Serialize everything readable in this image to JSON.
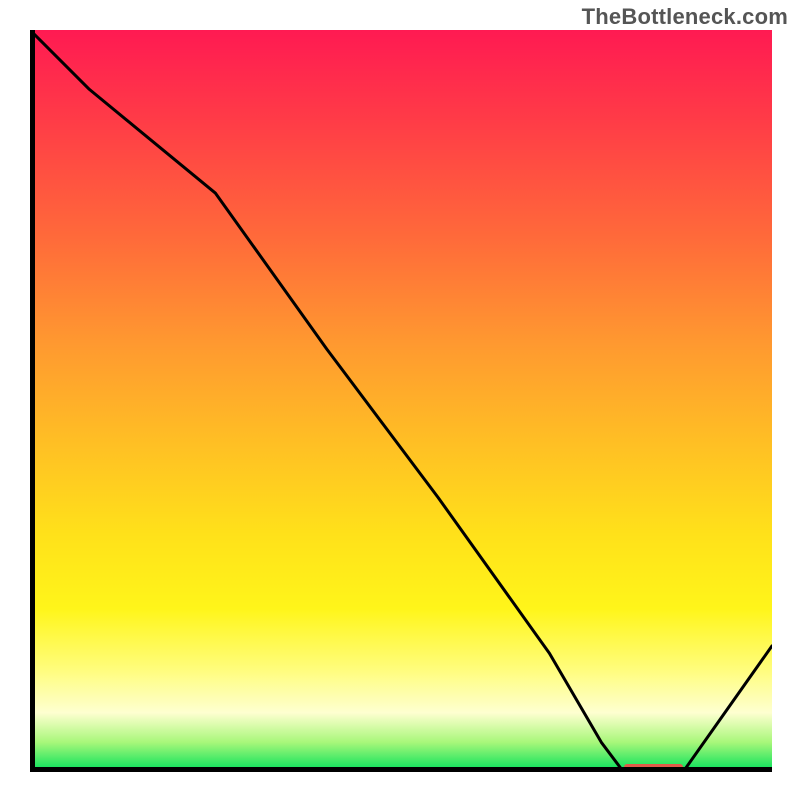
{
  "watermark": "TheBottleneck.com",
  "colors": {
    "axis": "#000000",
    "curve": "#000000",
    "marker": "#e05a4a",
    "gradient_top": "#ff1a52",
    "gradient_bottom": "#00e05a"
  },
  "chart_data": {
    "type": "line",
    "title": "",
    "xlabel": "",
    "ylabel": "",
    "xlim": [
      0,
      100
    ],
    "ylim": [
      0,
      100
    ],
    "grid": false,
    "legend": false,
    "series": [
      {
        "name": "curve",
        "x": [
          0,
          8,
          25,
          40,
          55,
          70,
          77,
          80,
          84,
          88,
          100
        ],
        "values": [
          100,
          92,
          78,
          57,
          37,
          16,
          4,
          0,
          0,
          0,
          17
        ]
      }
    ],
    "marker": {
      "name": "highlight-segment",
      "x_start": 80,
      "x_end": 88,
      "y": 0
    },
    "background": {
      "type": "vertical-gradient",
      "stops": [
        {
          "pos": 0,
          "color": "#ff1a52"
        },
        {
          "pos": 50,
          "color": "#ffb028"
        },
        {
          "pos": 80,
          "color": "#fff51a"
        },
        {
          "pos": 95,
          "color": "#feffd0"
        },
        {
          "pos": 100,
          "color": "#00e05a"
        }
      ]
    }
  }
}
